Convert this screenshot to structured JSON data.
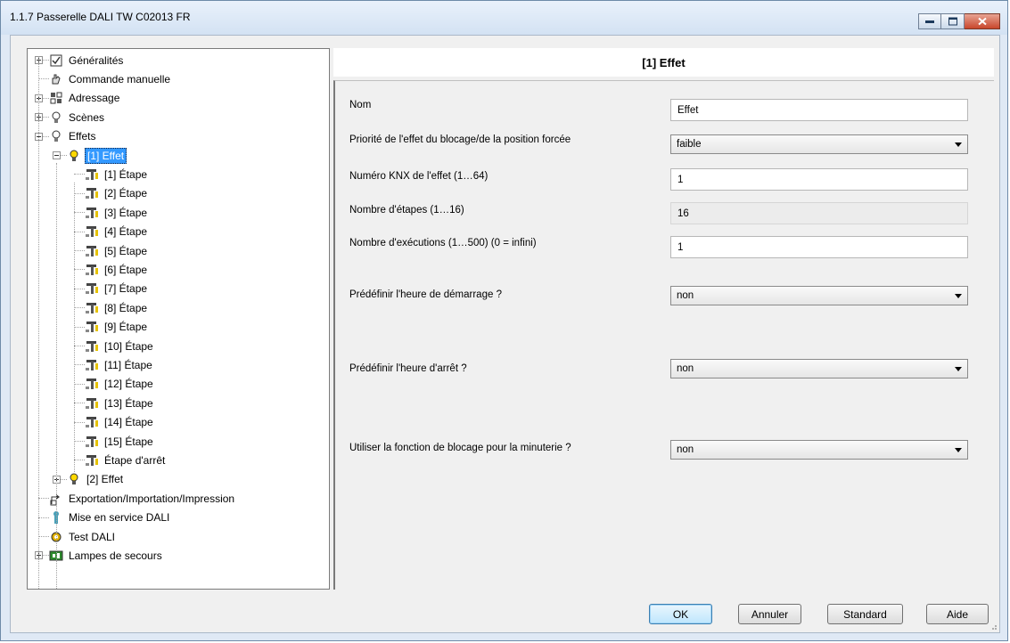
{
  "window": {
    "title": "1.1.7 Passerelle DALI TW C02013 FR",
    "controls": [
      "minimize",
      "maximize",
      "close"
    ]
  },
  "tree": {
    "items": [
      {
        "label": "Généralités",
        "icon": "checklist-icon",
        "expander": "plus"
      },
      {
        "label": "Commande manuelle",
        "icon": "hand-icon",
        "expander": ""
      },
      {
        "label": "Adressage",
        "icon": "grid-icon",
        "expander": "plus"
      },
      {
        "label": "Scènes",
        "icon": "bulb-icon",
        "expander": "plus"
      },
      {
        "label": "Effets",
        "icon": "bulb-icon",
        "expander": "minus"
      },
      {
        "label": "[1] Effet",
        "icon": "bulb-lit-icon",
        "expander": "minus",
        "selected": true
      },
      {
        "label": "[1] Étape",
        "icon": "step-icon"
      },
      {
        "label": "[2] Étape",
        "icon": "step-icon"
      },
      {
        "label": "[3] Étape",
        "icon": "step-icon"
      },
      {
        "label": "[4] Étape",
        "icon": "step-icon"
      },
      {
        "label": "[5] Étape",
        "icon": "step-icon"
      },
      {
        "label": "[6] Étape",
        "icon": "step-icon"
      },
      {
        "label": "[7] Étape",
        "icon": "step-icon"
      },
      {
        "label": "[8] Étape",
        "icon": "step-icon"
      },
      {
        "label": "[9] Étape",
        "icon": "step-icon"
      },
      {
        "label": "[10] Étape",
        "icon": "step-icon"
      },
      {
        "label": "[11] Étape",
        "icon": "step-icon"
      },
      {
        "label": "[12] Étape",
        "icon": "step-icon"
      },
      {
        "label": "[13] Étape",
        "icon": "step-icon"
      },
      {
        "label": "[14] Étape",
        "icon": "step-icon"
      },
      {
        "label": "[15] Étape",
        "icon": "step-icon"
      },
      {
        "label": "Étape d'arrêt",
        "icon": "step-icon"
      },
      {
        "label": "[2] Effet",
        "icon": "bulb-lit-icon",
        "expander": "plus"
      },
      {
        "label": "Exportation/Importation/Impression",
        "icon": "export-icon"
      },
      {
        "label": "Mise en service DALI",
        "icon": "wrench-icon"
      },
      {
        "label": "Test DALI",
        "icon": "gear-icon"
      },
      {
        "label": "Lampes de secours",
        "icon": "emergency-lamp-icon",
        "expander": "plus"
      }
    ]
  },
  "panel": {
    "title": "[1] Effet",
    "params": [
      {
        "label": "Nom",
        "type": "input",
        "value": "Effet"
      },
      {
        "label": "Priorité de l'effet du blocage/de la position forcée",
        "type": "select",
        "value": "faible"
      },
      {
        "label": "Numéro KNX de l'effet (1…64)",
        "type": "input",
        "value": "1"
      },
      {
        "label": "Nombre d'étapes (1…16)",
        "type": "readonly",
        "value": "16"
      },
      {
        "label": "Nombre d'exécutions (1…500) (0 = infini)",
        "type": "input",
        "value": "1"
      },
      {
        "label": "Prédéfinir l'heure de démarrage ?",
        "type": "select",
        "value": "non"
      },
      {
        "label": "Prédéfinir l'heure d'arrêt ?",
        "type": "select",
        "value": "non"
      },
      {
        "label": "Utiliser la fonction de blocage pour la minuterie ?",
        "type": "select",
        "value": "non"
      }
    ]
  },
  "buttons": {
    "ok": "OK",
    "cancel": "Annuler",
    "standard": "Standard",
    "help": "Aide"
  },
  "colors": {
    "selection": "#3399ff",
    "titlebar": "#dbe7f4",
    "close_button": "#c8462b"
  }
}
